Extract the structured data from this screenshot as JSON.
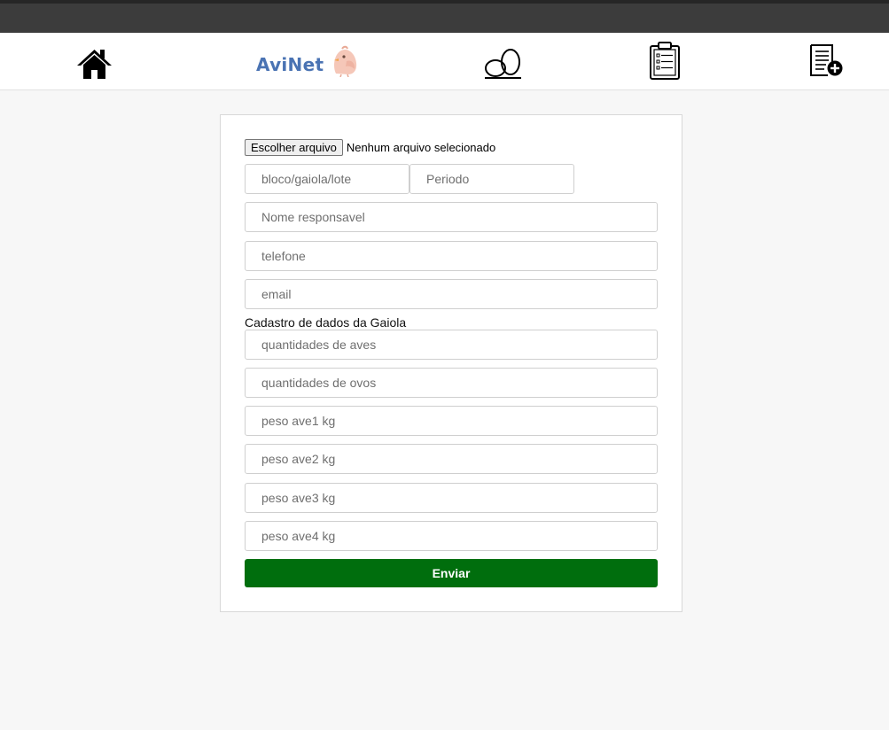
{
  "nav": {
    "logo_text": "AviNet",
    "icons": [
      "home-icon",
      "avinet-logo",
      "eggs-icon",
      "clipboard-icon",
      "add-report-icon"
    ]
  },
  "form": {
    "file_button_label": "Escolher arquivo",
    "file_status": "Nenhum arquivo selecionado",
    "location_placeholder": "bloco/gaiola/lote",
    "period_placeholder": "Periodo",
    "responsible_placeholder": "Nome responsavel",
    "phone_placeholder": "telefone",
    "email_placeholder": "email",
    "cage_section_label": "Cadastro de dados da Gaiola",
    "birds_qty_placeholder": "quantidades de aves",
    "eggs_qty_placeholder": "quantidades de ovos",
    "weight1_placeholder": "peso ave1 kg",
    "weight2_placeholder": "peso ave2 kg",
    "weight3_placeholder": "peso ave3 kg",
    "weight4_placeholder": "peso ave4 kg",
    "submit_label": "Enviar"
  },
  "colors": {
    "submit_bg": "#006e0d",
    "logo_text": "#4a73b3",
    "topbar": "#3c3c3c"
  }
}
